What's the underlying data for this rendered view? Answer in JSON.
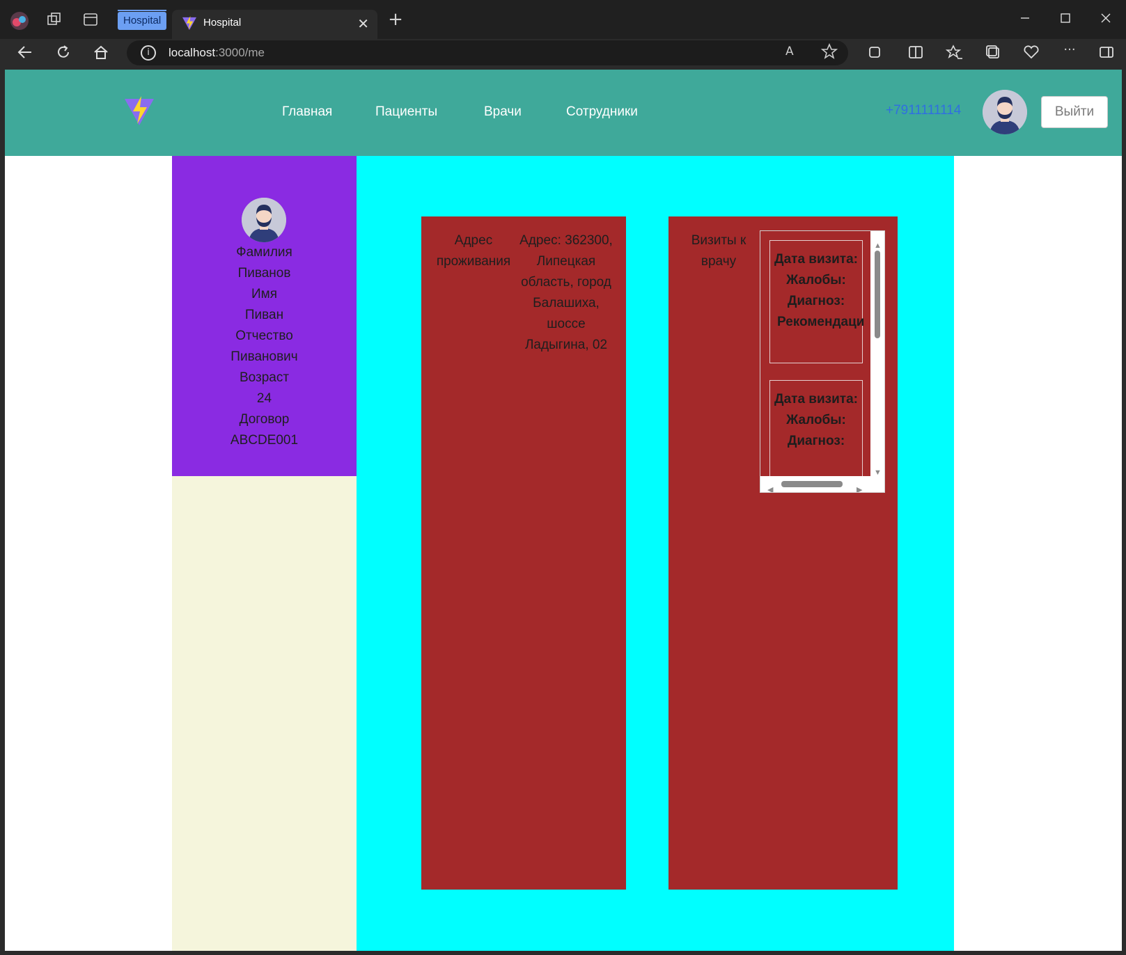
{
  "browser": {
    "group_label": "Hospital",
    "tab_title": "Hospital",
    "url_host": "localhost",
    "url_path": ":3000/me",
    "tab_close": "✕",
    "new_tab": "+"
  },
  "header": {
    "nav": [
      "Главная",
      "Пациенты",
      "Врачи",
      "Сотрудники"
    ],
    "phone": "+7911111114",
    "logout_label": "Выйти"
  },
  "profile": {
    "fields": [
      {
        "label": "Фамилия",
        "value": "Пиванов"
      },
      {
        "label": "Имя",
        "value": "Пиван"
      },
      {
        "label": "Отчество",
        "value": "Пиванович"
      },
      {
        "label": "Возраст",
        "value": "24"
      },
      {
        "label": "Договор",
        "value": "ABCDE001"
      }
    ]
  },
  "address_card": {
    "label": "Адрес проживания",
    "value": "Адрес: 362300, Липецкая область, город Балашиха, шоссе Ладыгина, 02"
  },
  "visits_card": {
    "label": "Визиты к врачу",
    "visit_fields": [
      "Дата визита:",
      "Жалобы:",
      "Диагноз:",
      "Рекомендаци"
    ]
  },
  "colors": {
    "header_bg": "#3fa99a",
    "sidebar_top": "#8a2be2",
    "sidebar_bottom": "#f5f5dc",
    "main_bg": "#00ffff",
    "card_bg": "#a4292a"
  }
}
